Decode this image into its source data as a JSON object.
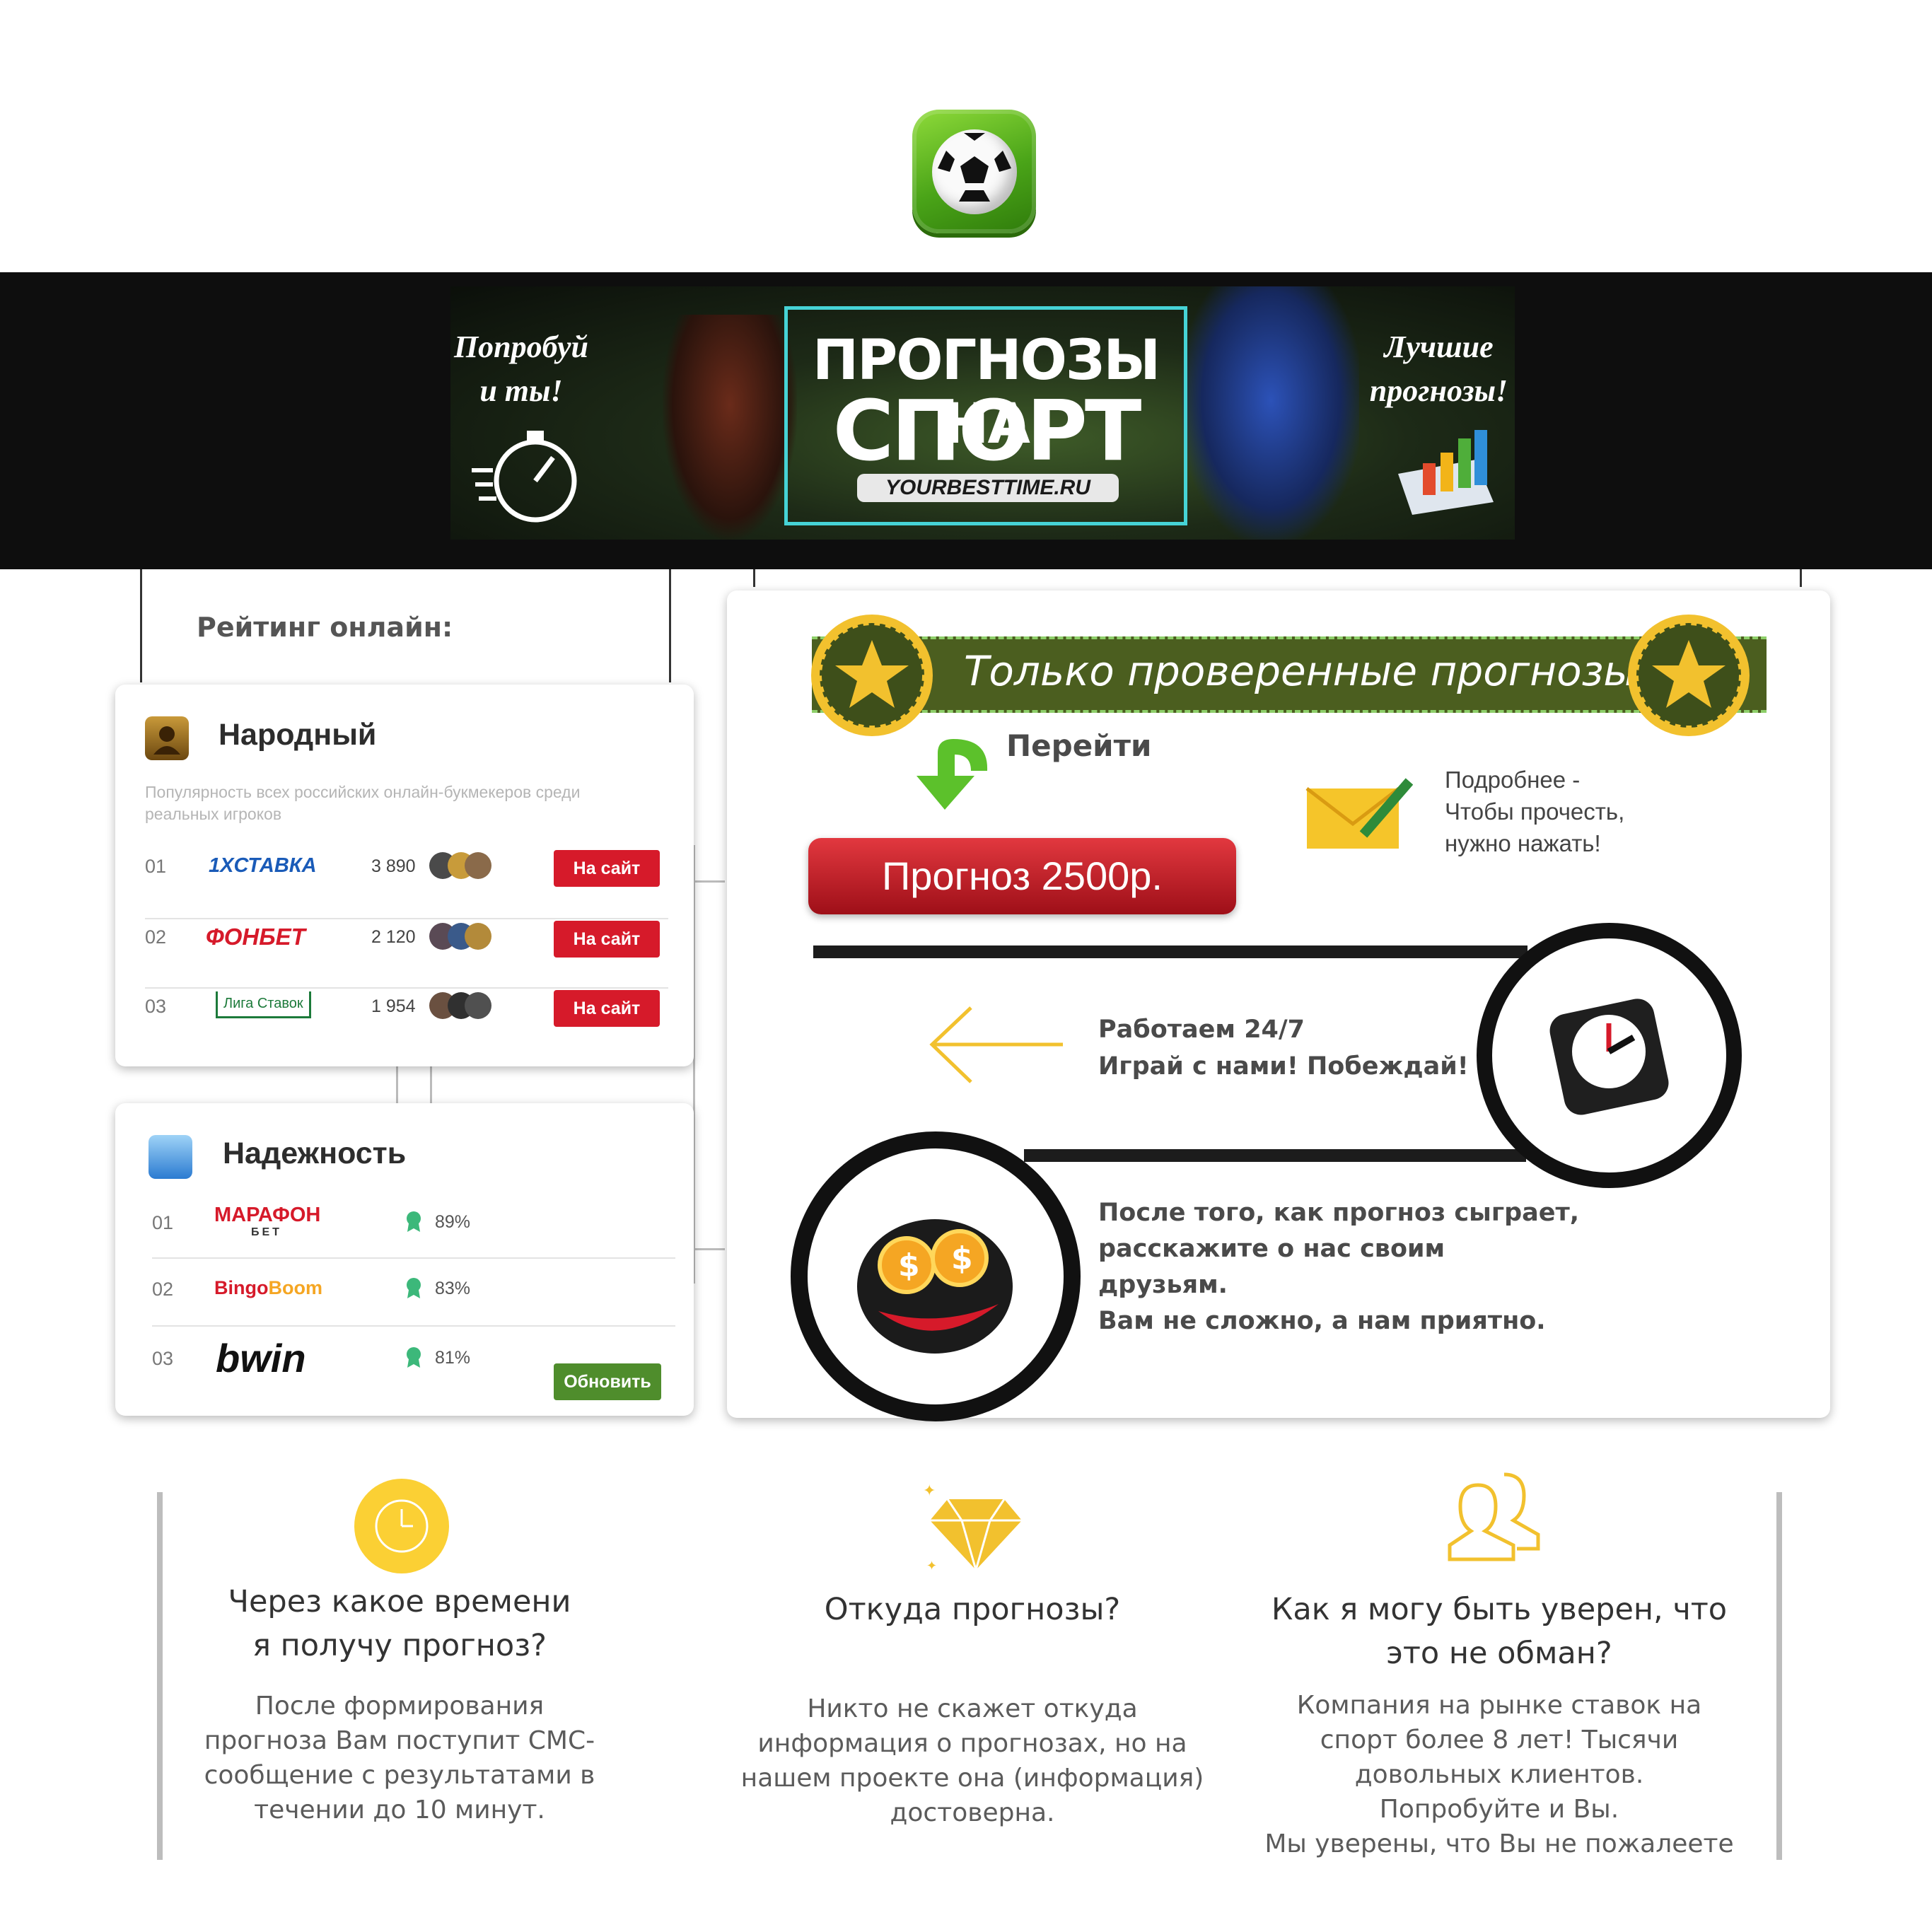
{
  "header": {
    "logo_icon": "soccer-ball-icon"
  },
  "banner": {
    "left_text_1": "Попробуй",
    "left_text_2": "и ты!",
    "title_line1": "ПРОГНОЗЫ НА",
    "title_line2": "СПОРТ",
    "url": "YOURBESTTIME.RU",
    "right_text_1": "Лучшие",
    "right_text_2": "прогнозы!"
  },
  "sidebar": {
    "rating_label": "Рейтинг онлайн:",
    "popular": {
      "title": "Народный",
      "subtitle": "Популярность всех российских онлайн-букмекеров среди реальных игроков",
      "rows": [
        {
          "num": "01",
          "brand": "1XСТАВКА",
          "count": "3 890",
          "button": "На сайт"
        },
        {
          "num": "02",
          "brand": "ФОНБЕТ",
          "count": "2 120",
          "button": "На сайт"
        },
        {
          "num": "03",
          "brand": "Лига Ставок",
          "count": "1 954",
          "button": "На сайт"
        }
      ]
    },
    "reliability": {
      "title": "Надежность",
      "rows": [
        {
          "num": "01",
          "brand": "МАРАФОН",
          "brand_sub": "БЕТ",
          "pct": "89%"
        },
        {
          "num": "02",
          "brand_a": "Bingo",
          "brand_b": "Boom",
          "pct": "83%"
        },
        {
          "num": "03",
          "brand": "bwin",
          "pct": "81%"
        }
      ],
      "update_button": "Обновить"
    }
  },
  "main": {
    "ribbon_title": "Только проверенные прогнозы!",
    "go_label": "Перейти",
    "forecast_button": "Прогноз 2500р.",
    "details_1": "Подробнее -",
    "details_2": "Чтобы прочесть,",
    "details_3": "нужно нажать!",
    "work_1": "Работаем 24/7",
    "work_2": "Играй с нами! Побеждай!",
    "after_1": "После того, как прогноз сыграет,",
    "after_2": "расскажите о нас своим",
    "after_3": "друзьям.",
    "after_4": "Вам не сложно, а нам приятно."
  },
  "faq": [
    {
      "icon": "clock-icon",
      "title_1": "Через какое времени",
      "title_2": "я получу прогноз?",
      "body": [
        "После формирования",
        "прогноза Вам поступит СМС-",
        "сообщение с результатами в",
        "течении до 10 минут."
      ]
    },
    {
      "icon": "diamond-icon",
      "title_1": "Откуда прогнозы?",
      "title_2": "",
      "body": [
        "Никто не скажет откуда",
        "информация о прогнозах, но на",
        "нашем проекте она (информация)",
        "достоверна."
      ]
    },
    {
      "icon": "users-icon",
      "title_1": "Как я могу быть уверен, что",
      "title_2": "это не обман?",
      "body": [
        "Компания на рынке ставок на",
        "спорт более 8 лет! Тысячи",
        "довольных клиентов.",
        "Попробуйте и Вы.",
        "Мы уверены, что Вы не пожалеете"
      ]
    }
  ],
  "colors": {
    "accent_red": "#d61a2a",
    "accent_green": "#4f8d2c",
    "ribbon_green": "#4b5e1f",
    "gold": "#f2c12e",
    "band": "#0e0e0e"
  }
}
